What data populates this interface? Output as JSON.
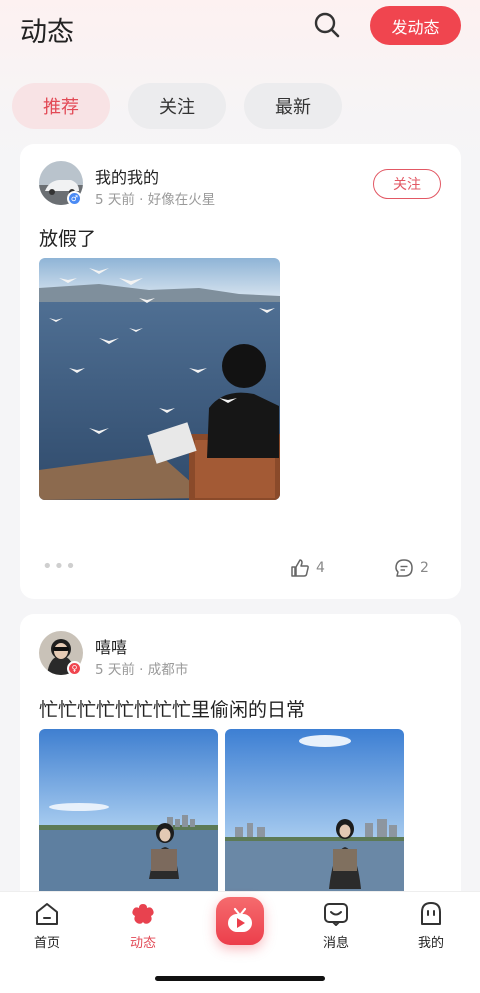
{
  "header": {
    "title": "动态",
    "post_button": "发动态"
  },
  "tabs": [
    {
      "label": "推荐",
      "active": true
    },
    {
      "label": "关注",
      "active": false
    },
    {
      "label": "最新",
      "active": false
    }
  ],
  "posts": [
    {
      "username": "我的我的",
      "meta": "5 天前 · 好像在火星",
      "gender": "male",
      "follow_label": "关注",
      "text": "放假了",
      "more": "•••",
      "likes": "4",
      "comments": "2"
    },
    {
      "username": "嘻嘻",
      "meta": "5 天前 · 成都市",
      "gender": "female",
      "text": "忙忙忙忙忙忙忙忙里偷闲的日常"
    }
  ],
  "tabbar": [
    {
      "label": "首页",
      "icon": "home-icon",
      "active": false
    },
    {
      "label": "动态",
      "icon": "flower-icon",
      "active": true
    },
    {
      "label": "",
      "icon": "tv-icon",
      "active": false
    },
    {
      "label": "消息",
      "icon": "message-icon",
      "active": false
    },
    {
      "label": "我的",
      "icon": "profile-icon",
      "active": false
    }
  ],
  "colors": {
    "accent": "#f0454f",
    "active_tab_text": "#e24a56",
    "active_tab_bg": "#f8e3e5"
  }
}
